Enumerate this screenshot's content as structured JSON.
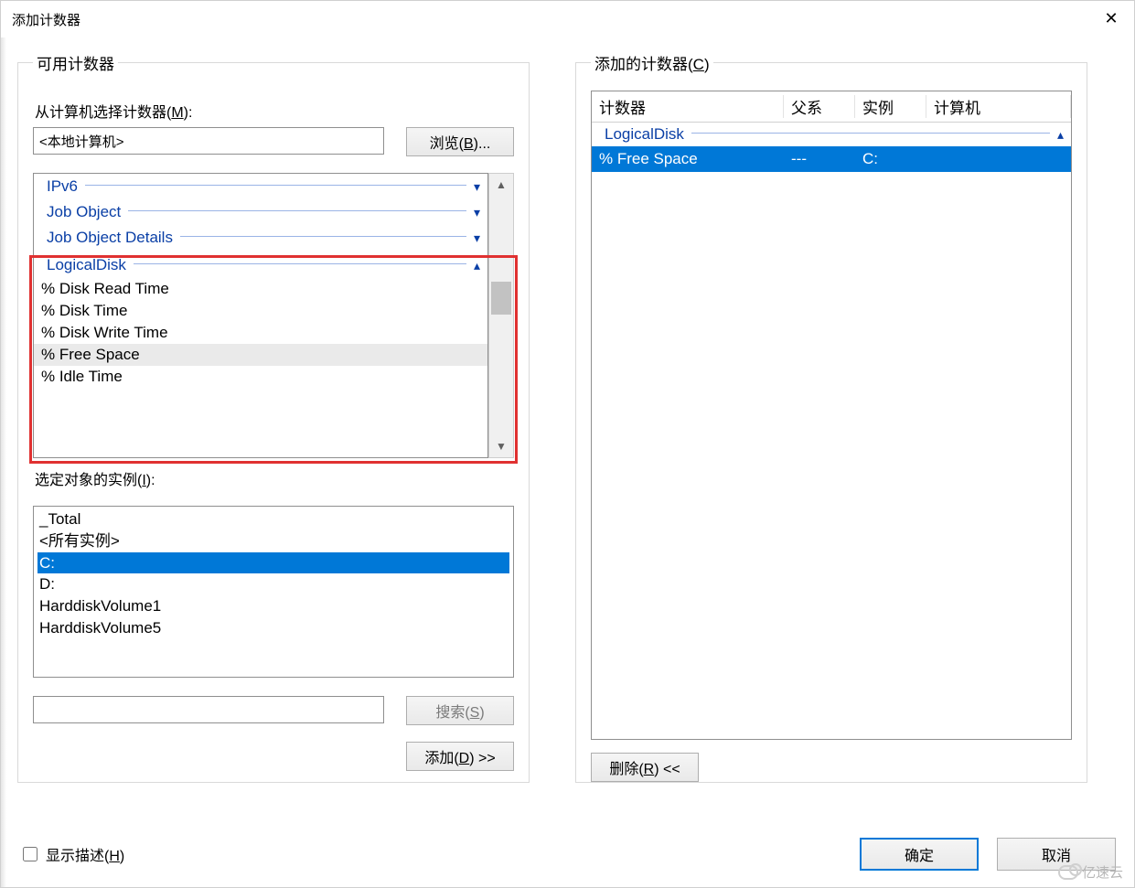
{
  "window": {
    "title": "添加计数器"
  },
  "left": {
    "groupTitle": "可用计数器",
    "computerLabelPre": "从计算机选择计数器(",
    "computerLabelKey": "M",
    "computerLabelPost": "):",
    "computerValue": "<本地计算机>",
    "browseLabelPre": "浏览(",
    "browseLabelKey": "B",
    "browseLabelPost": ")...",
    "categories": [
      {
        "name": "IPv6",
        "expanded": false
      },
      {
        "name": "Job Object",
        "expanded": false
      },
      {
        "name": "Job Object Details",
        "expanded": false
      },
      {
        "name": "LogicalDisk",
        "expanded": true,
        "counters": [
          "% Disk Read Time",
          "% Disk Time",
          "% Disk Write Time",
          "% Free Space",
          "% Idle Time"
        ],
        "selectedCounter": "% Free Space"
      }
    ],
    "instancesLabelPre": "选定对象的实例(",
    "instancesLabelKey": "I",
    "instancesLabelPost": "):",
    "instances": [
      "_Total",
      "<所有实例>",
      "C:",
      "D:",
      "HarddiskVolume1",
      "HarddiskVolume5"
    ],
    "instanceSelected": "C:",
    "searchLabelPre": "搜索(",
    "searchLabelKey": "S",
    "searchLabelPost": ")",
    "addLabelPre": "添加(",
    "addLabelKey": "D",
    "addLabelPost": ") >>"
  },
  "right": {
    "groupTitlePre": "添加的计数器(",
    "groupTitleKey": "C",
    "groupTitlePost": ")",
    "columns": {
      "counter": "计数器",
      "parent": "父系",
      "instance": "实例",
      "computer": "计算机"
    },
    "groups": [
      {
        "name": "LogicalDisk",
        "rows": [
          {
            "counter": "% Free Space",
            "parent": "---",
            "instance": "C:",
            "computer": ""
          }
        ]
      }
    ],
    "removeLabelPre": "删除(",
    "removeLabelKey": "R",
    "removeLabelPost": ") <<"
  },
  "footer": {
    "showDescPre": "显示描述(",
    "showDescKey": "H",
    "showDescPost": ")",
    "ok": "确定",
    "cancel": "取消"
  },
  "watermark": "亿速云"
}
